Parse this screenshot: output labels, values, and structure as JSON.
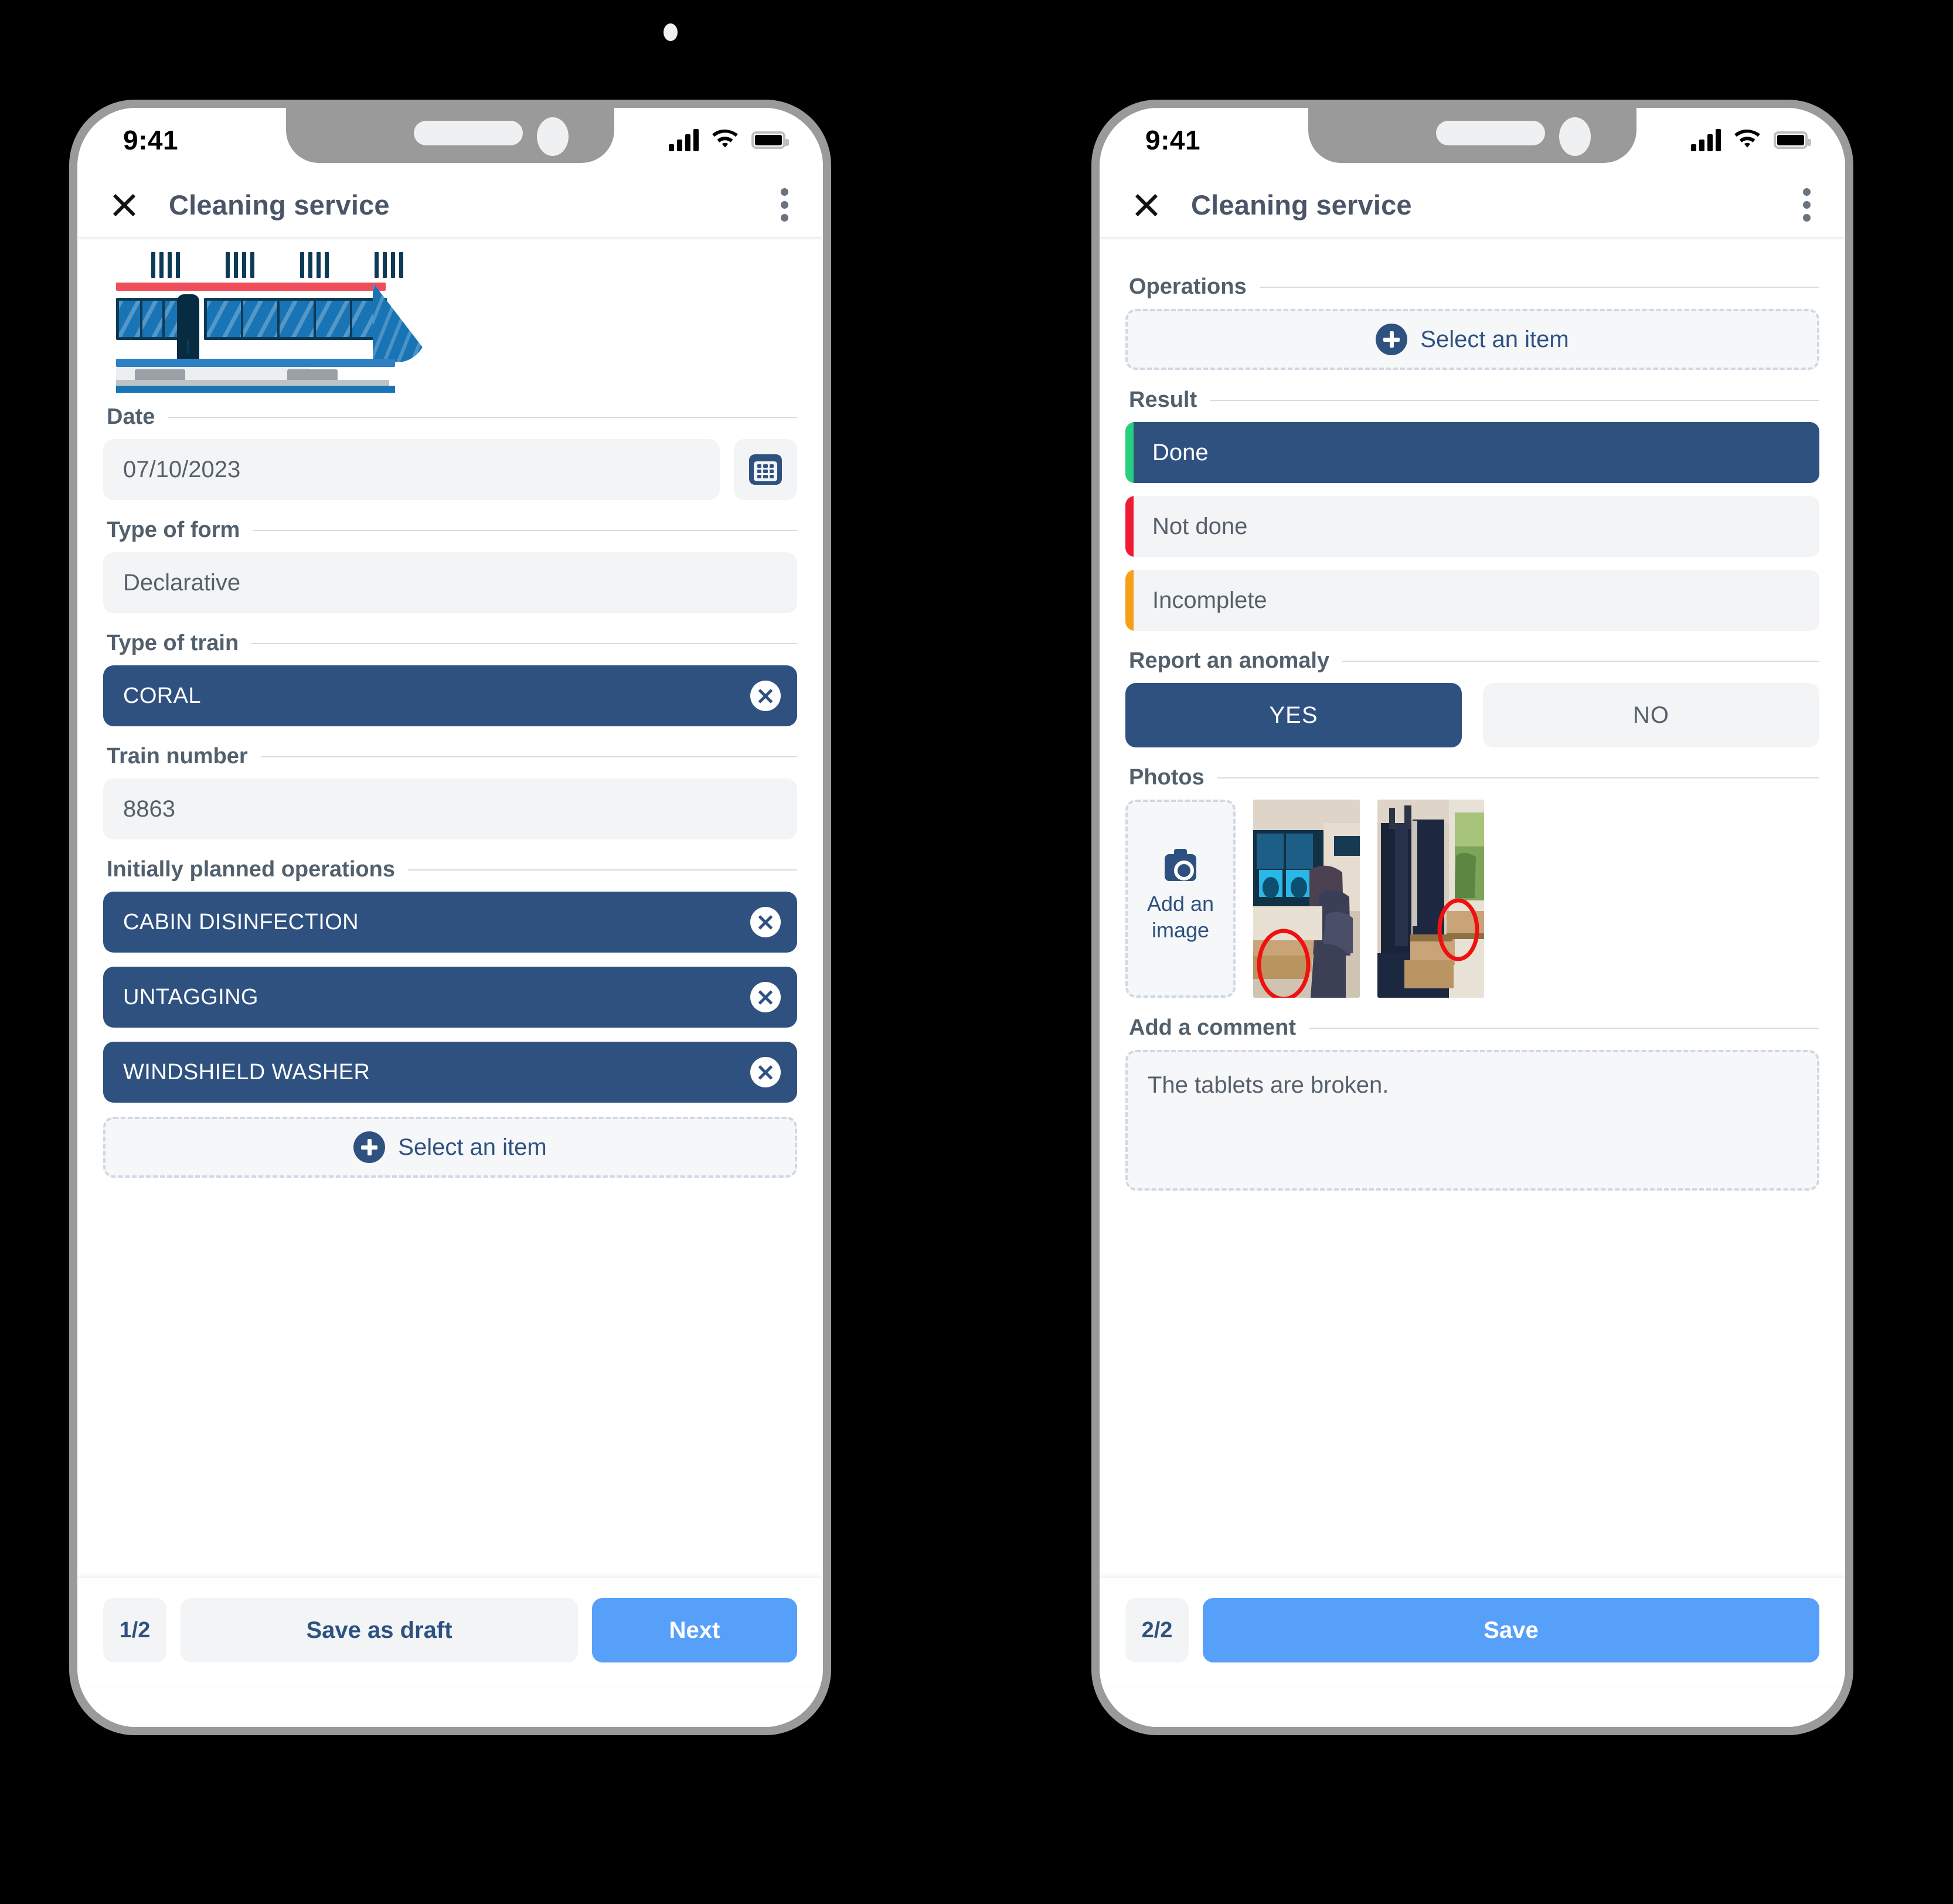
{
  "status_bar": {
    "time": "9:41",
    "icons": [
      "signal-bars-icon",
      "wifi-icon",
      "battery-icon"
    ]
  },
  "app": {
    "title": "Cleaning service",
    "close_icon": "close-icon",
    "menu_icon": "kebab-menu-icon"
  },
  "colors": {
    "navy": "#2f5180",
    "primary_blue": "#57a0fa",
    "field_bg": "#f2f4f6",
    "done_green": "#27d07f",
    "notdone_red": "#ef1b35",
    "incomplete_orange": "#f6a016",
    "annotation_red": "#ef1111",
    "train_red": "#ef4d5a",
    "train_blue": "#1874b5",
    "train_dark": "#0d3a56"
  },
  "screen1": {
    "illustration": "train-illustration",
    "fields": [
      {
        "label": "Date",
        "value": "07/10/2023",
        "trailing_icon": "calendar-icon"
      },
      {
        "label": "Type of form",
        "value": "Declarative"
      },
      {
        "label": "Type of train",
        "chips": [
          "CORAL"
        ]
      },
      {
        "label": "Train number",
        "value": "8863"
      },
      {
        "label": "Initially planned operations",
        "chips": [
          "CABIN DISINFECTION",
          "UNTAGGING",
          "WINDSHIELD WASHER"
        ]
      }
    ],
    "labels": {
      "date": "Date",
      "type_of_form": "Type of form",
      "type_of_train": "Type of train",
      "train_number": "Train number",
      "initially_planned_operations": "Initially planned operations"
    },
    "values": {
      "date": "07/10/2023",
      "type_of_form": "Declarative",
      "train_number": "8863"
    },
    "chips": {
      "type_of_train": [
        "CORAL"
      ],
      "operations": [
        "CABIN DISINFECTION",
        "UNTAGGING",
        "WINDSHIELD WASHER"
      ]
    },
    "select_an_item": "Select an item",
    "bottom": {
      "page": "1/2",
      "secondary": "Save as draft",
      "primary": "Next"
    }
  },
  "screen2": {
    "labels": {
      "operations": "Operations",
      "result": "Result",
      "report_an_anomaly": "Report an anomaly",
      "photos": "Photos",
      "add_a_comment": "Add a comment"
    },
    "select_an_item": "Select an item",
    "result_options": [
      {
        "label": "Done",
        "stripe": "#27d07f",
        "selected": true
      },
      {
        "label": "Not done",
        "stripe": "#ef1b35",
        "selected": false
      },
      {
        "label": "Incomplete",
        "stripe": "#f6a016",
        "selected": false
      }
    ],
    "anomaly": {
      "yes": "YES",
      "no": "NO",
      "selected": "YES"
    },
    "photos": {
      "add_label_line1": "Add an",
      "add_label_line2": "image",
      "add_icon": "camera-icon",
      "thumbnails": [
        "train-interior-screens-photo",
        "train-seats-tray-photo"
      ]
    },
    "comment": "The tablets are broken.",
    "bottom": {
      "page": "2/2",
      "primary": "Save"
    }
  }
}
